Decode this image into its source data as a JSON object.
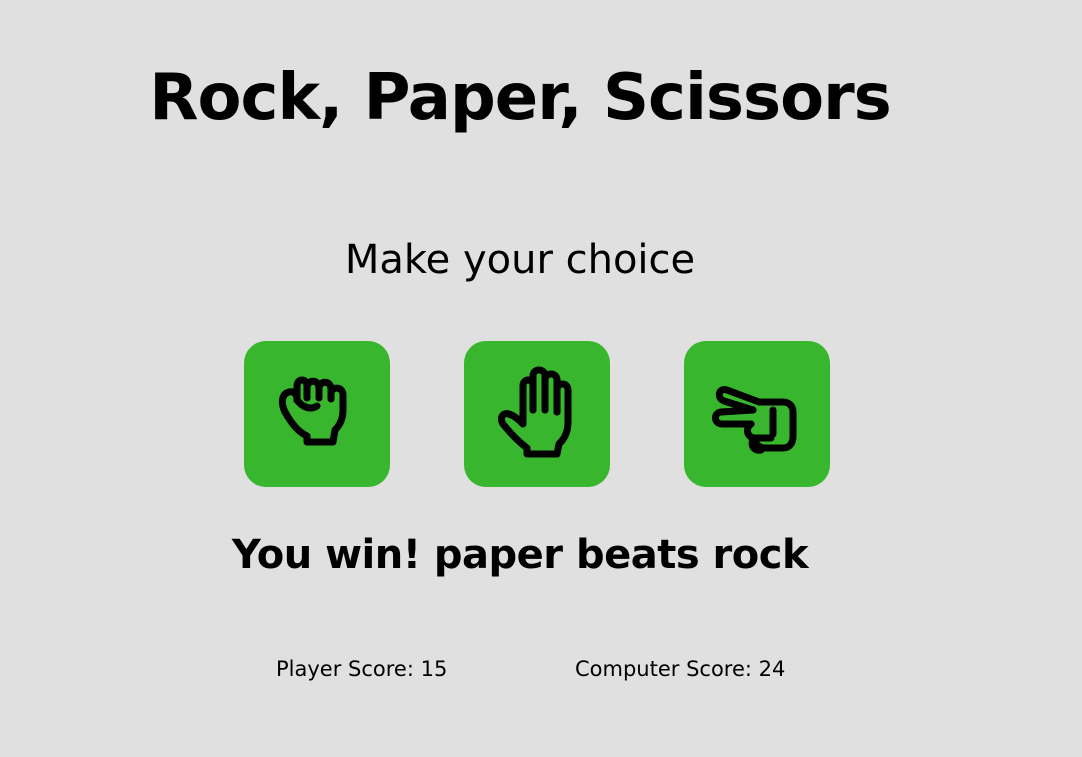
{
  "header": {
    "title": "Rock, Paper, Scissors"
  },
  "game": {
    "prompt": "Make your choice",
    "choices": [
      {
        "name": "rock",
        "icon": "rock-hand-icon"
      },
      {
        "name": "paper",
        "icon": "paper-hand-icon"
      },
      {
        "name": "scissors",
        "icon": "scissors-hand-icon"
      }
    ],
    "result": "You win! paper beats rock"
  },
  "scores": {
    "player_label": "Player Score: 15",
    "computer_label": "Computer Score: 24"
  },
  "colors": {
    "background": "#e0e0e0",
    "button": "#38b62e",
    "text": "#000000"
  }
}
